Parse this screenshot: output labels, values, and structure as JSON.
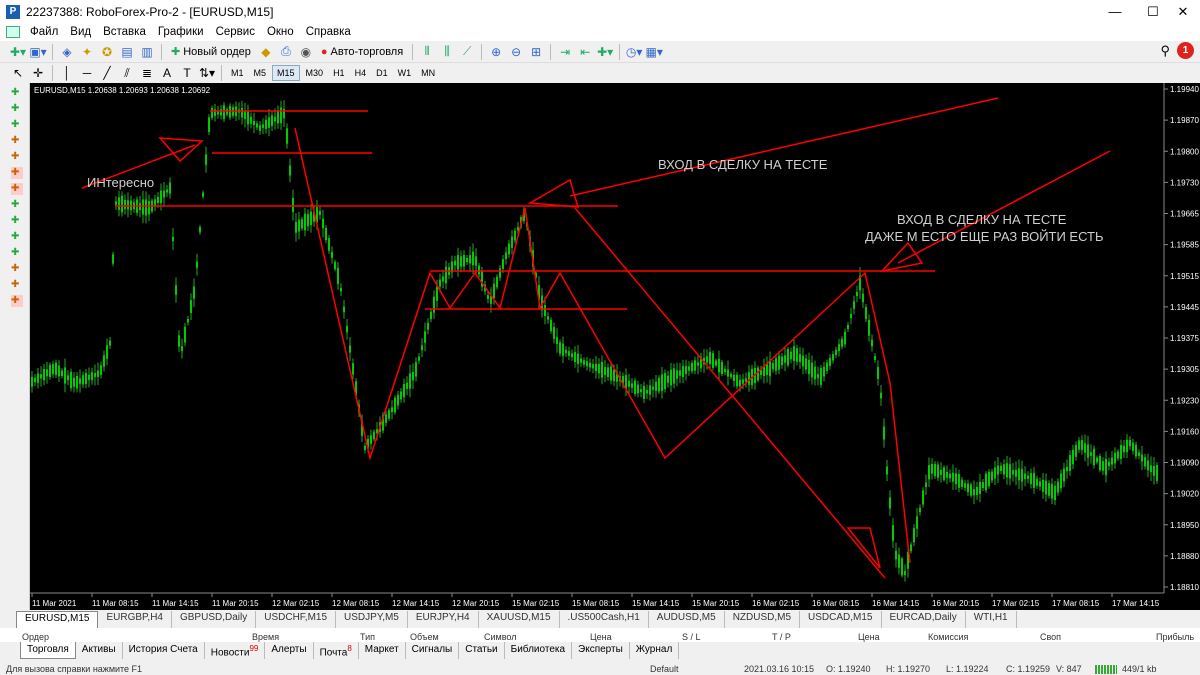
{
  "window": {
    "title": "22237388: RoboForex-Pro-2 - [EURUSD,M15]",
    "minimize": "—",
    "maximize": "☐",
    "close": "✕"
  },
  "menu": [
    "Файл",
    "Вид",
    "Вставка",
    "Графики",
    "Сервис",
    "Окно",
    "Справка"
  ],
  "toolbar": {
    "new_order": "Новый ордер",
    "auto_trading": "Авто-торговля"
  },
  "timeframes": [
    "M1",
    "M5",
    "M15",
    "M30",
    "H1",
    "H4",
    "D1",
    "W1",
    "MN"
  ],
  "active_timeframe": "M15",
  "notifications": "1",
  "chart": {
    "header": "EURUSD,M15  1.20638 1.20693 1.20638 1.20692",
    "price_labels": [
      "1.19940",
      "1.19870",
      "1.19800",
      "1.19730",
      "1.19665",
      "1.19585",
      "1.19515",
      "1.19445",
      "1.19375",
      "1.19305",
      "1.19230",
      "1.19160",
      "1.19090",
      "1.19020",
      "1.18950",
      "1.18880",
      "1.18810"
    ],
    "time_labels": [
      "11 Mar 2021",
      "11 Mar 08:15",
      "11 Mar 14:15",
      "11 Mar 20:15",
      "12 Mar 02:15",
      "12 Mar 08:15",
      "12 Mar 14:15",
      "12 Mar 20:15",
      "15 Mar 02:15",
      "15 Mar 08:15",
      "15 Mar 14:15",
      "15 Mar 20:15",
      "16 Mar 02:15",
      "16 Mar 08:15",
      "16 Mar 14:15",
      "16 Mar 20:15",
      "17 Mar 02:15",
      "17 Mar 08:15",
      "17 Mar 14:15"
    ],
    "annotations": {
      "interesting": "ИНтересно",
      "entry1": "ВХОД В СДЕЛКУ НА ТЕСТЕ",
      "entry2_line1": "ВХОД В СДЕЛКУ НА ТЕСТЕ",
      "entry2_line2": "ДАЖЕ М ЕСТО ЕЩЕ РАЗ ВОЙТИ ЕСТЬ"
    },
    "candle_color": "#00ff00",
    "drawing_color": "#ff0000"
  },
  "chart_tabs": [
    "EURUSD,M15",
    "EURGBP,H4",
    "GBPUSD,Daily",
    "USDCHF,M15",
    "USDJPY,M5",
    "EURJPY,H4",
    "XAUUSD,M15",
    ".US500Cash,H1",
    "AUDUSD,M5",
    "NZDUSD,M5",
    "USDCAD,M15",
    "EURCAD,Daily",
    "WTI,H1"
  ],
  "terminal_columns": [
    "Ордер",
    "Время",
    "Тип",
    "Объем",
    "Символ",
    "Цена",
    "S / L",
    "T / P",
    "Цена",
    "Комиссия",
    "Своп",
    "Прибыль"
  ],
  "bottom_tabs": [
    {
      "label": "Торговля",
      "badge": ""
    },
    {
      "label": "Активы",
      "badge": ""
    },
    {
      "label": "История Счета",
      "badge": ""
    },
    {
      "label": "Новости",
      "badge": "99"
    },
    {
      "label": "Алерты",
      "badge": ""
    },
    {
      "label": "Почта",
      "badge": "8"
    },
    {
      "label": "Маркет",
      "badge": ""
    },
    {
      "label": "Сигналы",
      "badge": ""
    },
    {
      "label": "Статьи",
      "badge": ""
    },
    {
      "label": "Библиотека",
      "badge": ""
    },
    {
      "label": "Эксперты",
      "badge": ""
    },
    {
      "label": "Журнал",
      "badge": ""
    }
  ],
  "status": {
    "help": "Для вызова справки нажмите F1",
    "profile": "Default",
    "datetime": "2021.03.16 10:15",
    "open": "O: 1.19240",
    "high": "H: 1.19270",
    "low": "L: 1.19224",
    "close": "C: 1.19259",
    "volume": "V: 847",
    "traffic": "449/1 kb"
  }
}
